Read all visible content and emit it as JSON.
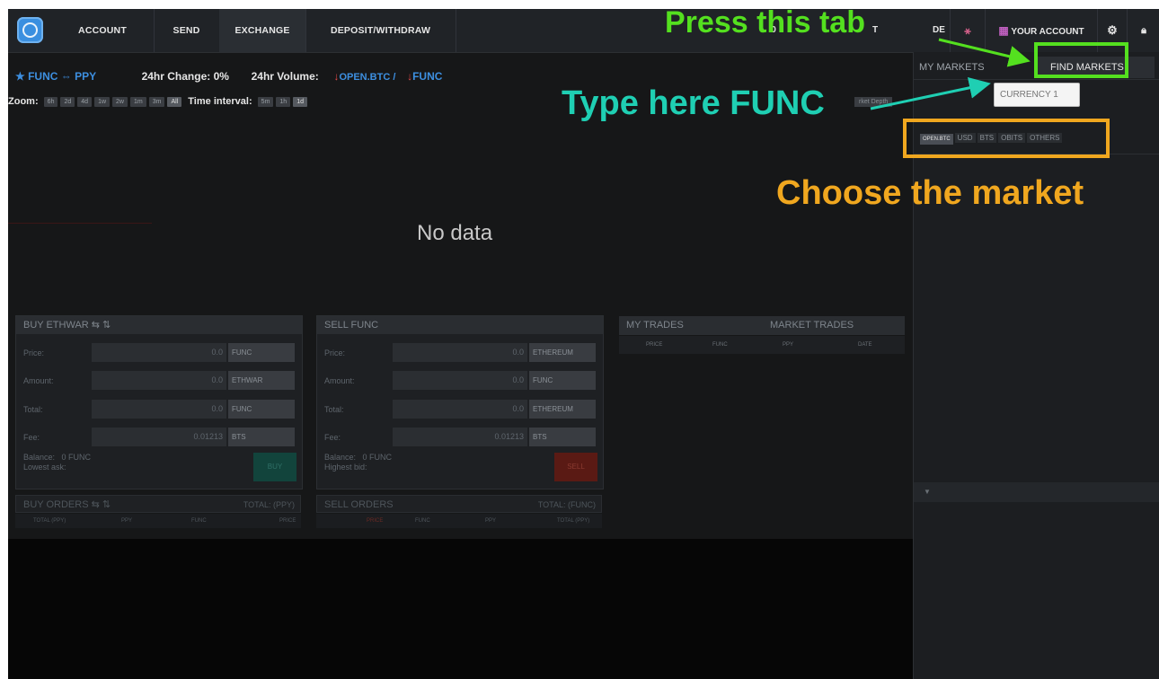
{
  "nav": {
    "tabs": [
      "ACCOUNT",
      "SEND",
      "EXCHANGE",
      "DEPOSIT/WITHDRAW"
    ],
    "right_partial_1": "0",
    "right_partial_2": "T",
    "right_partial_3": "DE",
    "account": "YOUR ACCOUNT"
  },
  "market": {
    "pair": "★ FUNC ⇔ PPY",
    "change_label": "24hr Change: 0%",
    "volume_label": "24hr Volume:",
    "vol_btc": "OPEN.BTC /",
    "vol_func": "FUNC"
  },
  "zoom": {
    "label": "Zoom:",
    "options": [
      "6h",
      "2d",
      "4d",
      "1w",
      "2w",
      "1m",
      "3m",
      "All"
    ],
    "interval_label": "Time interval:",
    "intervals": [
      "5m",
      "1h",
      "1d"
    ],
    "depth_btn": "rket Depth"
  },
  "chart": {
    "nodata": "No data"
  },
  "buy": {
    "title": "BUY ETHWAR ⇆ ⇅",
    "price_label": "Price:",
    "price_val": "0.0",
    "price_unit": "FUNC",
    "amount_label": "Amount:",
    "amount_val": "0.0",
    "amount_unit": "ETHWAR",
    "total_label": "Total:",
    "total_val": "0.0",
    "total_unit": "FUNC",
    "fee_label": "Fee:",
    "fee_val": "0.01213",
    "fee_unit": "BTS",
    "balance_label": "Balance:",
    "balance_val": "0 FUNC",
    "ask_label": "Lowest ask:",
    "button": "BUY"
  },
  "sell": {
    "title": "SELL FUNC",
    "price_label": "Price:",
    "price_val": "0.0",
    "price_unit": "ETHEREUM",
    "amount_label": "Amount:",
    "amount_val": "0.0",
    "amount_unit": "FUNC",
    "total_label": "Total:",
    "total_val": "0.0",
    "total_unit": "ETHEREUM",
    "fee_label": "Fee:",
    "fee_val": "0.01213",
    "fee_unit": "BTS",
    "balance_label": "Balance:",
    "balance_val": "0 FUNC",
    "bid_label": "Highest bid:",
    "button": "SELL"
  },
  "buy_orders": {
    "title": "BUY ORDERS ⇆ ⇅",
    "total": "TOTAL: (PPY)",
    "cols": [
      "TOTAL (PPY)",
      "PPY",
      "FUNC",
      "PRICE"
    ]
  },
  "sell_orders": {
    "title": "SELL ORDERS",
    "total": "TOTAL: (FUNC)",
    "cols": [
      "PRICE",
      "FUNC",
      "PPY",
      "TOTAL (PPY)"
    ]
  },
  "trades": {
    "my": "MY TRADES",
    "market": "MARKET TRADES",
    "cols": [
      "PRICE",
      "FUNC",
      "PPY",
      "DATE"
    ]
  },
  "sidebar": {
    "tab_my": "MY MARKETS",
    "tab_find": "FIND MARKETS",
    "currency_placeholder": "CURRENCY 1",
    "markets": [
      "OPEN.BTC",
      "USD",
      "BTS",
      "OBITS",
      "OTHERS"
    ],
    "collapse": "▼"
  },
  "annotations": {
    "press": "Press this tab",
    "type": "Type here FUNC",
    "choose": "Choose the market",
    "colors": {
      "green": "#54e01f",
      "teal": "#1fcfb3",
      "orange": "#f0a71f"
    }
  }
}
